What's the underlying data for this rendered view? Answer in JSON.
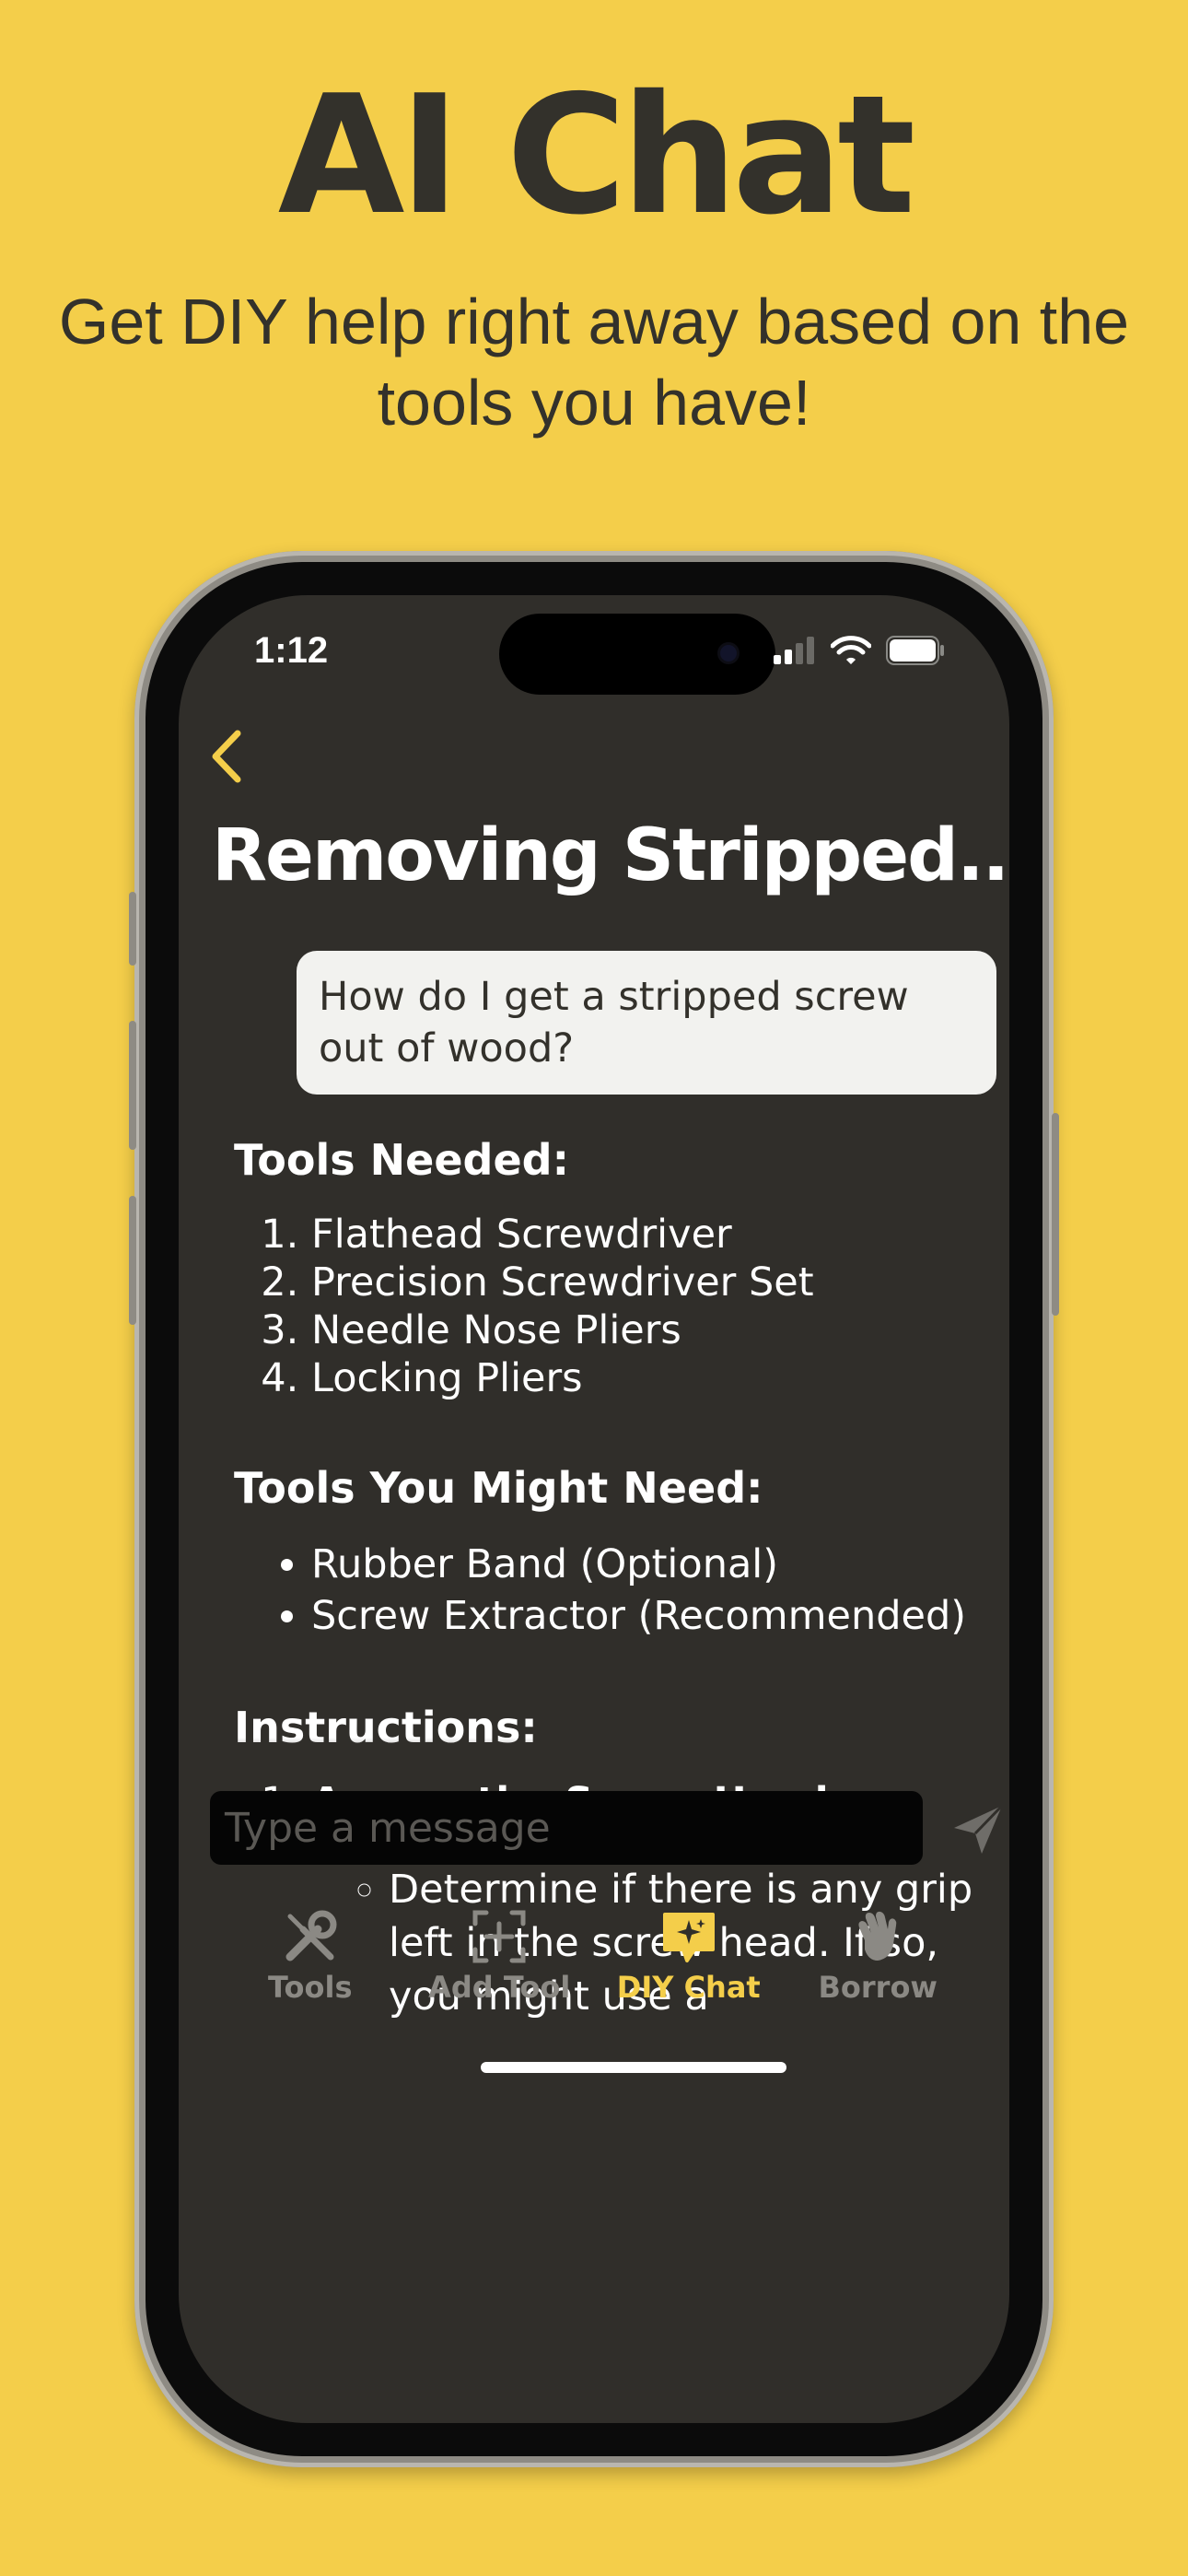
{
  "promo": {
    "title": "AI Chat",
    "subtitle": "Get DIY help right away based on the tools you have!"
  },
  "status_bar": {
    "time": "1:12"
  },
  "chat": {
    "title": "Removing Stripped...",
    "user_message": "How do I get a stripped screw out of wood?",
    "response": {
      "tools_needed_heading": "Tools Needed:",
      "tools_needed": [
        "Flathead Screwdriver",
        "Precision Screwdriver Set",
        "Needle Nose Pliers",
        "Locking Pliers"
      ],
      "tools_might_need_heading": "Tools You Might Need:",
      "tools_might_need": [
        "Rubber Band (Optional)",
        "Screw Extractor (Recommended)"
      ],
      "instructions_heading": "Instructions:",
      "step1_title": "Assess the Screw Head",
      "step1_colon": ":",
      "step1_text": "Determine if there is any grip left in the screw head. If so, you might use a"
    }
  },
  "input": {
    "placeholder": "Type a message"
  },
  "tabs": [
    {
      "label": "Tools",
      "icon": "tools-icon",
      "active": false
    },
    {
      "label": "Add Tool",
      "icon": "add-tool-icon",
      "active": false
    },
    {
      "label": "DIY Chat",
      "icon": "diy-chat-icon",
      "active": true
    },
    {
      "label": "Borrow",
      "icon": "wave-hand-icon",
      "active": false
    }
  ],
  "colors": {
    "background": "#F4CE4A",
    "screen": "#302E2A",
    "accent": "#F4CE4A",
    "text_dark": "#33312B"
  }
}
